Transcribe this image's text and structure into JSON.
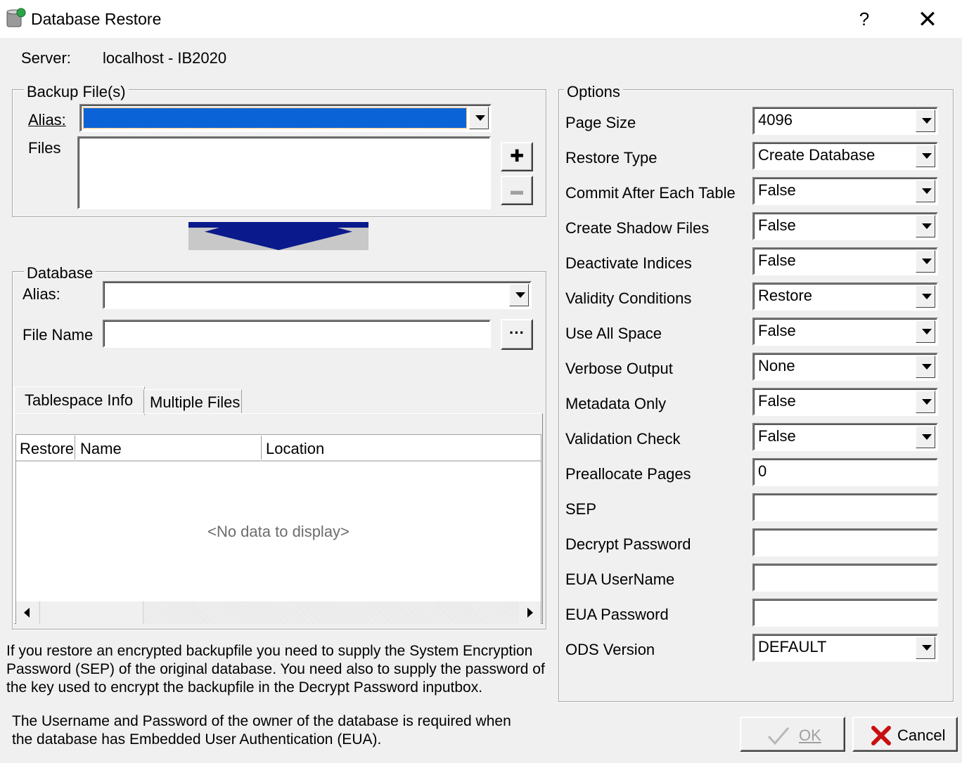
{
  "window": {
    "title": "Database Restore",
    "help": "?",
    "close": "✕"
  },
  "server": {
    "label": "Server:",
    "value": "localhost - IB2020"
  },
  "backup": {
    "legend": "Backup File(s)",
    "alias_label": "Alias:",
    "alias_value": "",
    "files_label": "Files",
    "add_glyph": "✚",
    "remove_glyph": "▬"
  },
  "database": {
    "legend": "Database",
    "alias_label": "Alias:",
    "alias_value": "",
    "filename_label": "File Name",
    "filename_value": "",
    "browse_label": "···"
  },
  "tabs": [
    {
      "label": "Tablespace Info",
      "active": true
    },
    {
      "label": "Multiple Files",
      "active": false
    }
  ],
  "grid": {
    "columns": [
      "Restore",
      "Name",
      "Location"
    ],
    "empty_text": "<No data to display>"
  },
  "notes": {
    "encryption": "If you restore an encrypted backupfile you need to supply the System Encryption Password (SEP) of the original database. You need also to supply the password of the key used to encrypt the backupfile  in the Decrypt Password inputbox.",
    "eua": "The Username and Password of the owner of the database is required when the database has Embedded User Authentication (EUA)."
  },
  "options": {
    "legend": "Options",
    "rows": [
      {
        "label": "Page Size",
        "value": "4096",
        "kind": "combo"
      },
      {
        "label": "Restore Type",
        "value": "Create Database",
        "kind": "combo"
      },
      {
        "label": "Commit After Each Table",
        "value": "False",
        "kind": "combo"
      },
      {
        "label": "Create Shadow Files",
        "value": "False",
        "kind": "combo"
      },
      {
        "label": "Deactivate Indices",
        "value": "False",
        "kind": "combo"
      },
      {
        "label": "Validity Conditions",
        "value": "Restore",
        "kind": "combo"
      },
      {
        "label": "Use All Space",
        "value": "False",
        "kind": "combo"
      },
      {
        "label": "Verbose Output",
        "value": "None",
        "kind": "combo"
      },
      {
        "label": "Metadata Only",
        "value": "False",
        "kind": "combo"
      },
      {
        "label": "Validation Check",
        "value": "False",
        "kind": "combo"
      },
      {
        "label": "Preallocate Pages",
        "value": "0",
        "kind": "text"
      },
      {
        "label": "SEP",
        "value": "",
        "kind": "text"
      },
      {
        "label": "Decrypt Password",
        "value": "",
        "kind": "text"
      },
      {
        "label": "EUA UserName",
        "value": "",
        "kind": "text"
      },
      {
        "label": "EUA Password",
        "value": "",
        "kind": "text"
      },
      {
        "label": "ODS Version",
        "value": "DEFAULT",
        "kind": "combo"
      }
    ]
  },
  "buttons": {
    "ok": "OK",
    "cancel": "Cancel"
  },
  "colors": {
    "selection": "#0a64d8",
    "arrow": "#0a1a8c",
    "arrow_bg": "#c8c8c8"
  }
}
